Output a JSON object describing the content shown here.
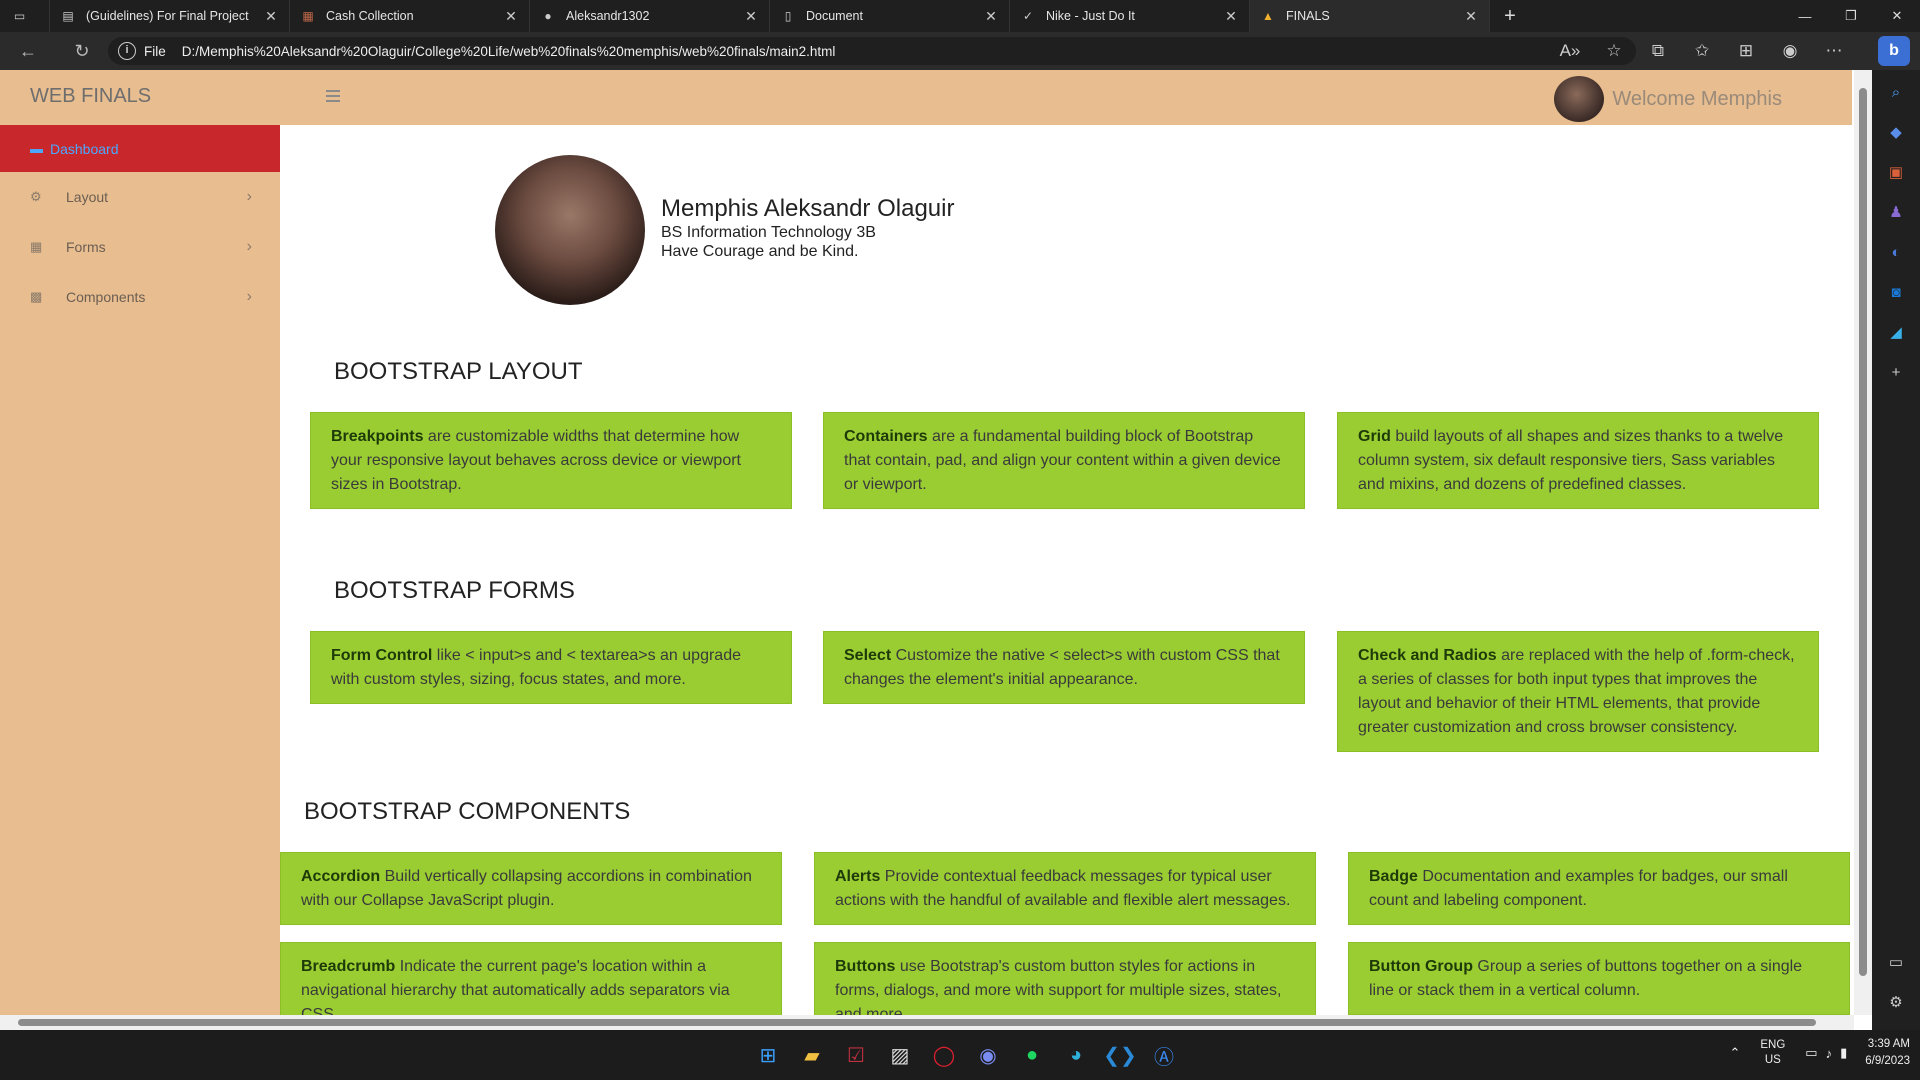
{
  "browser": {
    "tabs": [
      {
        "title": "(Guidelines) For Final Project",
        "icon": "doc-icon"
      },
      {
        "title": "Cash Collection",
        "icon": "sheet-icon"
      },
      {
        "title": "Aleksandr1302",
        "icon": "github-icon"
      },
      {
        "title": "Document",
        "icon": "page-icon"
      },
      {
        "title": "Nike - Just Do It",
        "icon": "nike-icon"
      },
      {
        "title": "FINALS",
        "icon": "finals-icon"
      }
    ],
    "new_tab": "+",
    "address_scheme": "File",
    "url": "D:/Memphis%20Aleksandr%20Olaguir/College%20Life/web%20finals%20memphis/web%20finals/main2.html"
  },
  "navbar": {
    "brand": "WEB FINALS",
    "welcome": "Welcome Memphis"
  },
  "sidebar": {
    "items": [
      {
        "label": "Dashboard"
      },
      {
        "label": "Layout"
      },
      {
        "label": "Forms"
      },
      {
        "label": "Components"
      }
    ]
  },
  "profile": {
    "name": "Memphis Aleksandr Olaguir",
    "course": "BS Information Technology 3B",
    "motto": "Have Courage and be Kind."
  },
  "sections": {
    "layout": {
      "title": "BOOTSTRAP LAYOUT",
      "cards": [
        {
          "term": "Breakpoints",
          "text": " are customizable widths that determine how your responsive layout behaves across device or viewport sizes in Bootstrap."
        },
        {
          "term": "Containers",
          "text": " are a fundamental building block of Bootstrap that contain, pad, and align your content within a given device or viewport."
        },
        {
          "term": "Grid",
          "text": " build layouts of all shapes and sizes thanks to a twelve column system, six default responsive tiers, Sass variables and mixins, and dozens of predefined classes."
        }
      ]
    },
    "forms": {
      "title": "BOOTSTRAP FORMS",
      "cards": [
        {
          "term": "Form Control",
          "text": " like < input>s and < textarea>s an upgrade with custom styles, sizing, focus states, and more."
        },
        {
          "term": "Select",
          "text": " Customize the native < select>s with custom CSS that changes the element's initial appearance."
        },
        {
          "term": "Check and Radios",
          "text": " are replaced with the help of .form-check, a series of classes for both input types that improves the layout and behavior of their HTML elements, that provide greater customization and cross browser consistency."
        }
      ]
    },
    "components": {
      "title": "BOOTSTRAP COMPONENTS",
      "cards": [
        {
          "term": "Accordion",
          "text": " Build vertically collapsing accordions in combination with our Collapse JavaScript plugin."
        },
        {
          "term": "Alerts",
          "text": " Provide contextual feedback messages for typical user actions with the handful of available and flexible alert messages."
        },
        {
          "term": "Badge",
          "text": " Documentation and examples for badges, our small count and labeling component."
        },
        {
          "term": "Breadcrumb",
          "text": " Indicate the current page's location within a navigational hierarchy that automatically adds separators via CSS."
        },
        {
          "term": "Buttons",
          "text": " use Bootstrap's custom button styles for actions in forms, dialogs, and more with support for multiple sizes, states, and more."
        },
        {
          "term": "Button Group",
          "text": " Group a series of buttons together on a single line or stack them in a vertical column."
        }
      ]
    }
  },
  "taskbar": {
    "lang_line1": "ENG",
    "lang_line2": "US",
    "time": "3:39 AM",
    "date": "6/9/2023"
  },
  "colors": {
    "accent_sidebar": "#e8bd8f",
    "active_item": "#c8282c",
    "card_green": "#9acd32"
  }
}
